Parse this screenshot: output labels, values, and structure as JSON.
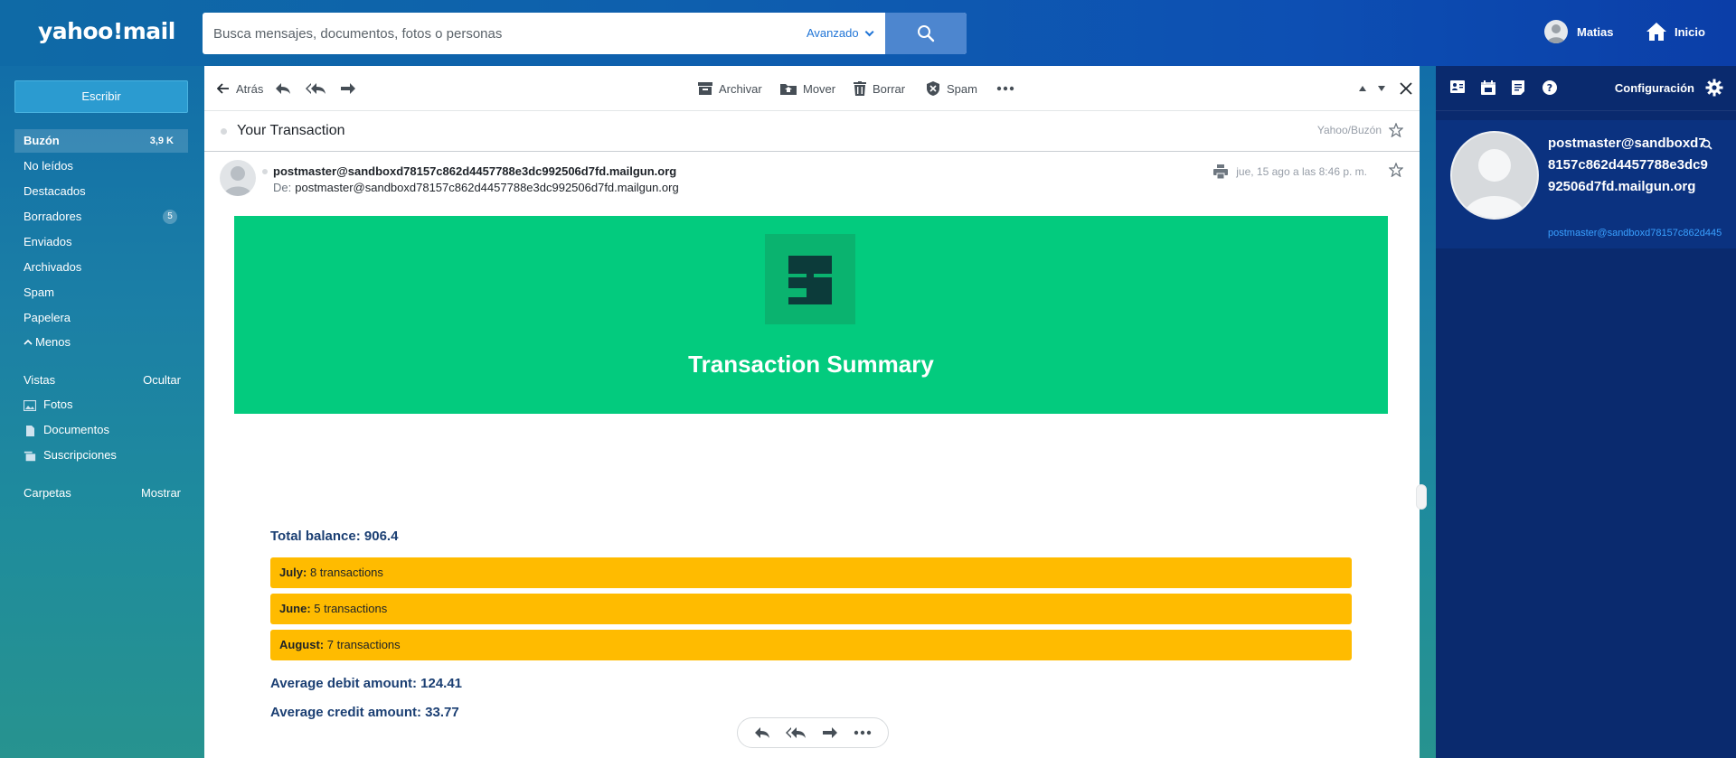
{
  "brand": {
    "logo_text": "yahoo!mail"
  },
  "search": {
    "placeholder": "Busca mensajes, documentos, fotos o personas",
    "advanced_label": "Avanzado"
  },
  "user": {
    "name": "Matias",
    "home_label": "Inicio"
  },
  "sidebar": {
    "compose_label": "Escribir",
    "folders": [
      {
        "label": "Buzón",
        "count": "3,9 K",
        "active": true
      },
      {
        "label": "No leídos"
      },
      {
        "label": "Destacados"
      },
      {
        "label": "Borradores",
        "badge": "5"
      },
      {
        "label": "Enviados"
      },
      {
        "label": "Archivados"
      },
      {
        "label": "Spam"
      },
      {
        "label": "Papelera"
      }
    ],
    "less_label": "Menos",
    "views": {
      "label": "Vistas",
      "action": "Ocultar",
      "items": [
        "Fotos",
        "Documentos",
        "Suscripciones"
      ]
    },
    "folders_section": {
      "label": "Carpetas",
      "action": "Mostrar"
    }
  },
  "toolbar": {
    "back": "Atrás",
    "archive": "Archivar",
    "move": "Mover",
    "delete": "Borrar",
    "spam": "Spam"
  },
  "message": {
    "subject": "Your Transaction",
    "folder_path": "Yahoo/Buzón",
    "from": "postmaster@sandboxd78157c862d4457788e3dc992506d7fd.mailgun.org",
    "to_label": "De:",
    "to": "postmaster@sandboxd78157c862d4457788e3dc992506d7fd.mailgun.org",
    "date": "jue, 15 ago a las 8:46 p. m."
  },
  "email": {
    "hero_title": "Transaction Summary",
    "hero_color": "#03cb7e",
    "total_balance": "Total balance: 906.4",
    "months": [
      {
        "month": "July:",
        "text": "8 transactions"
      },
      {
        "month": "June:",
        "text": "5 transactions"
      },
      {
        "month": "August:",
        "text": "7 transactions"
      }
    ],
    "avg_debit": "Average debit amount: 124.41",
    "avg_credit": "Average credit amount: 33.77"
  },
  "right_panel": {
    "settings_label": "Configuración",
    "contact_name": "postmaster@sandboxd78157c862d4457788e3dc992506d7fd.mailgun.org",
    "contact_email": "postmaster@sandboxd78157c862d445"
  },
  "icons": [
    "search-icon",
    "user-avatar-icon",
    "home-icon",
    "back-arrow-icon",
    "reply-icon",
    "reply-all-icon",
    "forward-icon",
    "archive-icon",
    "move-icon",
    "trash-icon",
    "spam-icon",
    "more-icon",
    "prev-icon",
    "next-icon",
    "close-icon",
    "star-icon",
    "print-icon",
    "photos-icon",
    "documents-icon",
    "subscriptions-icon",
    "contacts-icon",
    "calendar-icon",
    "notepad-icon",
    "help-icon",
    "gear-icon"
  ]
}
